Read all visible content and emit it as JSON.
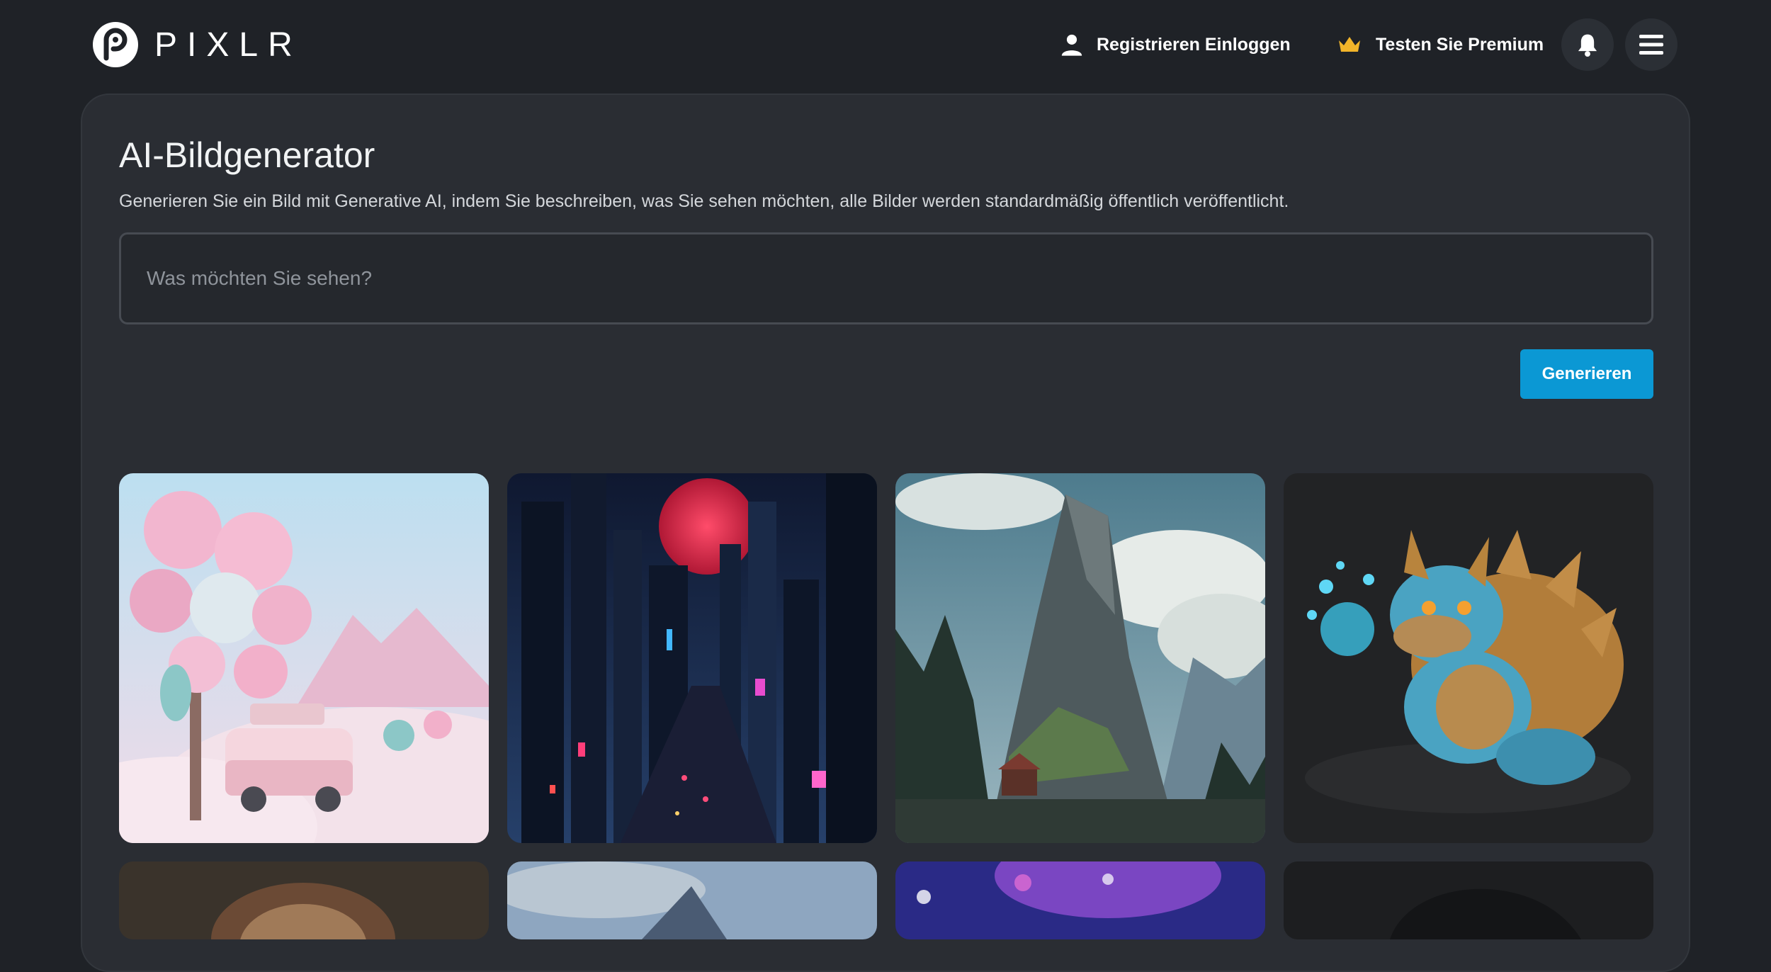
{
  "header": {
    "brand": "PIXLR",
    "logo_icon": "pixlr-logo-icon",
    "auth_label": "Registrieren Einloggen",
    "auth_icon": "user-icon",
    "premium_label": "Testen Sie Premium",
    "premium_icon": "crown-icon",
    "notification_icon": "bell-icon",
    "menu_icon": "hamburger-menu-icon"
  },
  "main": {
    "title": "AI-Bildgenerator",
    "subtitle": "Generieren Sie ein Bild mit Generative AI, indem Sie beschreiben, was Sie sehen möchten, alle Bilder werden standardmäßig öffentlich veröffentlicht.",
    "prompt": {
      "value": "",
      "placeholder": "Was möchten Sie sehen?"
    },
    "generate_label": "Generieren"
  },
  "colors": {
    "background": "#1f2227",
    "card": "#2a2d33",
    "accent": "#0b98d4",
    "crown": "#f2b52a"
  }
}
